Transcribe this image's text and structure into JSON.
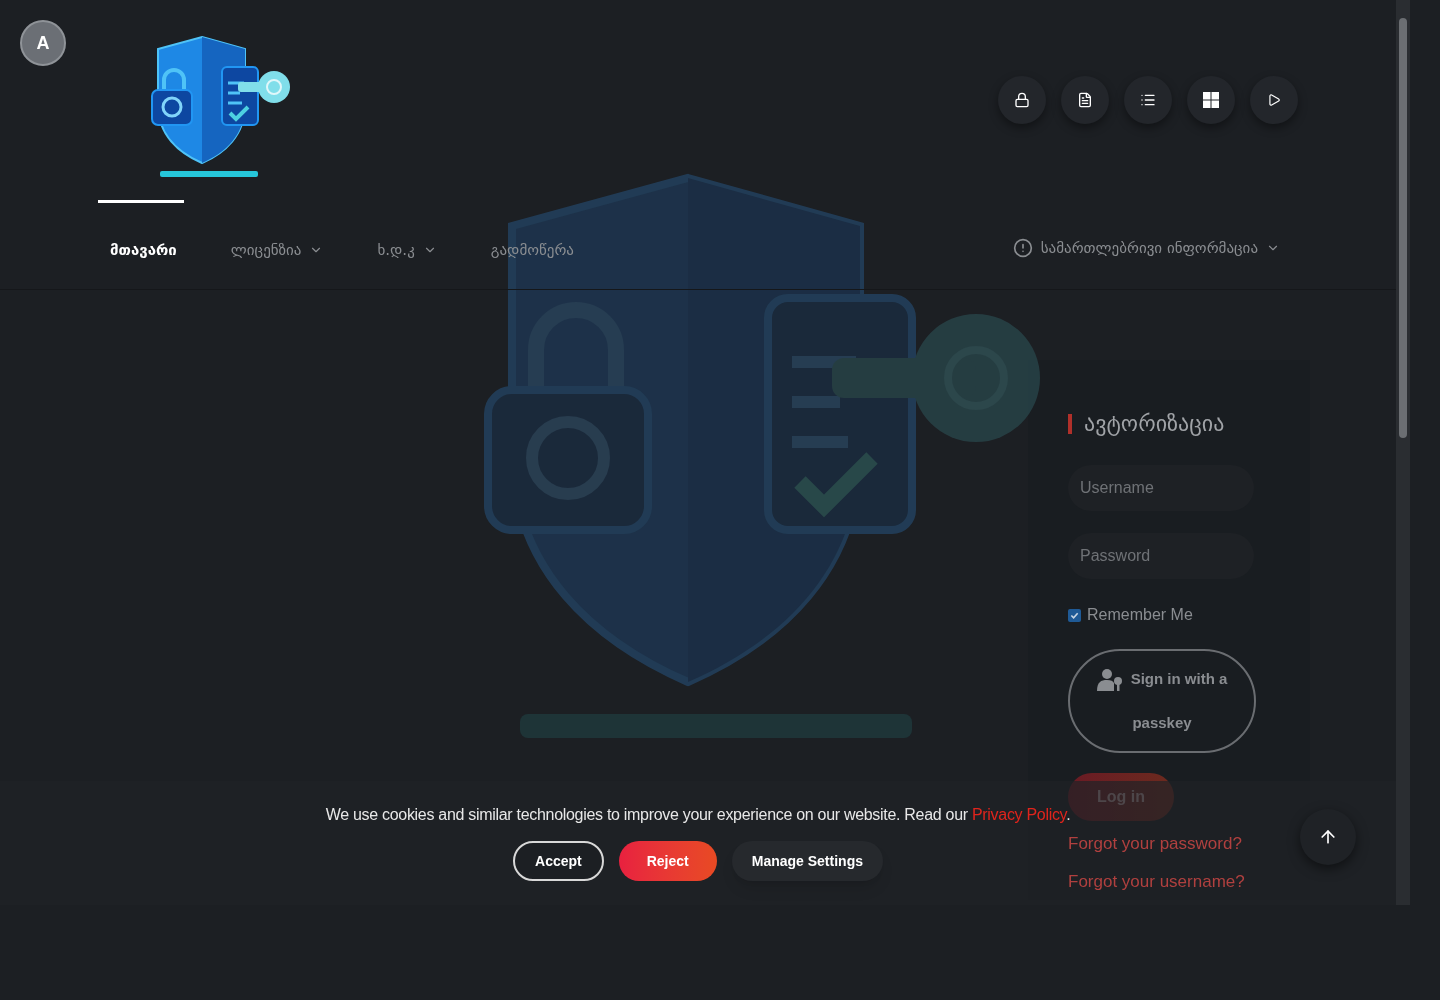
{
  "avatar": {
    "letter": "A"
  },
  "nav": {
    "items": [
      {
        "label": "მთავარი",
        "selected": true,
        "has_menu": false
      },
      {
        "label": "ლიცენზია",
        "selected": false,
        "has_menu": true
      },
      {
        "label": "ხ.დ.კ",
        "selected": false,
        "has_menu": true
      },
      {
        "label": "გადმოწერა",
        "selected": false,
        "has_menu": false
      }
    ],
    "legal": {
      "label": "სამართლებრივი ინფორმაცია",
      "has_menu": true
    }
  },
  "login": {
    "title": "ავტორიზაცია",
    "username": {
      "placeholder": "Username"
    },
    "password": {
      "placeholder": "Password"
    },
    "remember": {
      "label": "Remember Me",
      "checked": true
    },
    "passkey_button": "Sign in with a passkey",
    "login_button": "Log in",
    "links": [
      "Forgot your password?",
      "Forgot your username?"
    ]
  },
  "cookie_banner": {
    "text": "We use cookies and similar technologies to improve your experience on our website. Read our",
    "link": "Privacy Policy",
    "after": ".",
    "buttons": [
      {
        "label": "Accept",
        "kind": "outline"
      },
      {
        "label": "Reject",
        "kind": "danger"
      },
      {
        "label": "Manage Settings",
        "kind": "plain"
      }
    ]
  }
}
